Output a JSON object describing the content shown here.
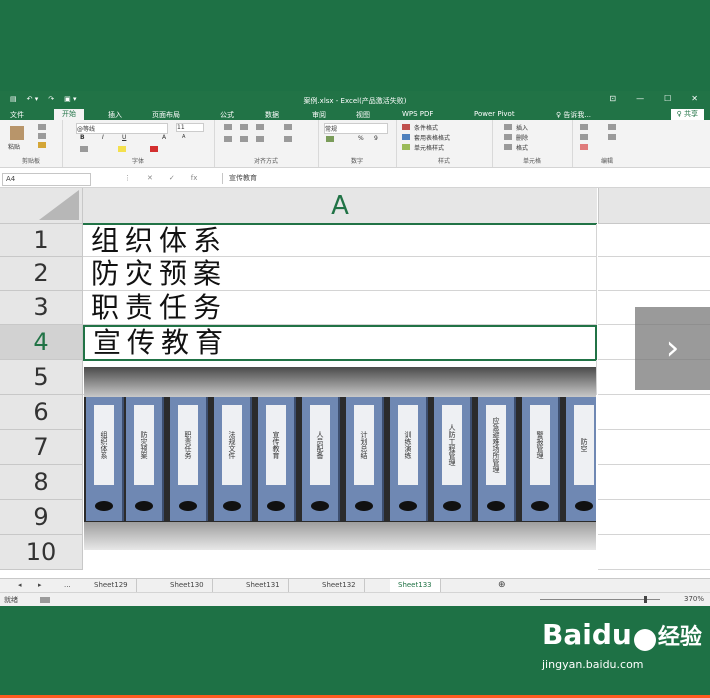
{
  "window": {
    "title": "案例.xlsx - Excel(产品激活失败)",
    "quick_access": [
      "▤",
      "↶ ▾",
      "↷",
      "▣ ▾"
    ],
    "controls": [
      "⊡",
      "—",
      "☐",
      "✕"
    ]
  },
  "ribbon_tabs": [
    "文件",
    "开始",
    "插入",
    "页面布局",
    "公式",
    "数据",
    "审阅",
    "视图",
    "WPS PDF",
    "Power Pivot"
  ],
  "tell_me": "♀ 告诉我...",
  "share": "♀ 共享",
  "ribbon": {
    "clipboard": {
      "paste": "粘贴",
      "label": "剪贴板"
    },
    "font": {
      "name": "@等线",
      "size": "11",
      "label": "字体",
      "bold": "B",
      "italic": "I",
      "underline": "U",
      "grow": "A",
      "shrink": "A"
    },
    "alignment": {
      "label": "对齐方式"
    },
    "number": {
      "format": "常规",
      "percent": "%",
      "comma": "9",
      "label": "数字"
    },
    "styles": {
      "conditional": "条件格式",
      "table": "套用表格格式",
      "cell": "单元格样式",
      "label": "样式"
    },
    "cells": {
      "insert": "插入",
      "delete": "删除",
      "format": "格式",
      "label": "单元格"
    },
    "editing": {
      "label": "编辑"
    }
  },
  "formula_bar": {
    "name_box": "A4",
    "icons": [
      "⋮",
      "✕",
      "✓",
      "fx"
    ],
    "value": "宣传教育"
  },
  "grid": {
    "column_header": "A",
    "rows": [
      {
        "num": "1",
        "text": "组织体系"
      },
      {
        "num": "2",
        "text": "防灾预案"
      },
      {
        "num": "3",
        "text": "职责任务"
      },
      {
        "num": "4",
        "text": "宣传教育"
      },
      {
        "num": "5",
        "text": ""
      },
      {
        "num": "6",
        "text": ""
      },
      {
        "num": "7",
        "text": ""
      },
      {
        "num": "8",
        "text": ""
      },
      {
        "num": "9",
        "text": ""
      },
      {
        "num": "10",
        "text": ""
      }
    ],
    "active_row": 4
  },
  "photo_binders": [
    "组织体系",
    "防灾预案",
    "职责任务",
    "法规文件",
    "宣传教育",
    "人员配备",
    "计划总结",
    "训练演练",
    "人防工程管理",
    "应急避难场所管理",
    "警报管理",
    "防空"
  ],
  "sheet_tabs": [
    "Sheet129",
    "Sheet130",
    "Sheet131",
    "Sheet132",
    "Sheet133"
  ],
  "active_sheet": "Sheet133",
  "sheet_nav": [
    "◂",
    "▸",
    "..."
  ],
  "status": {
    "mode": "就绪",
    "zoom": "370%"
  },
  "next_icon": "chevron-right",
  "watermark": {
    "brand": "Baidu",
    "cn": "经验",
    "url": "jingyan.baidu.com"
  }
}
